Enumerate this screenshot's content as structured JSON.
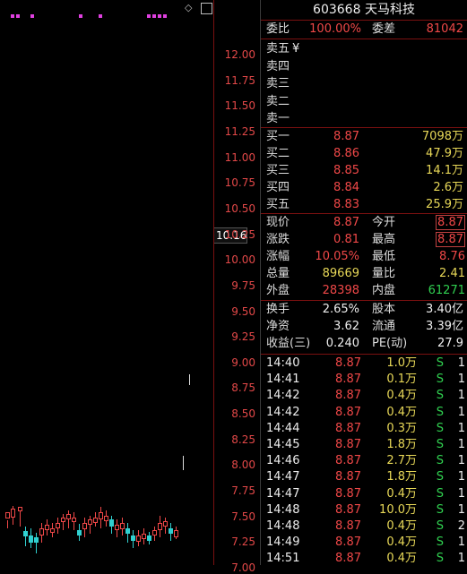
{
  "header": {
    "code": "603668",
    "name": "天马科技"
  },
  "ratio": {
    "label1": "委比",
    "value1": "100.00%",
    "label2": "委差",
    "value2": "81042"
  },
  "sell": [
    {
      "label": "卖五",
      "extra": "¥"
    },
    {
      "label": "卖四"
    },
    {
      "label": "卖三"
    },
    {
      "label": "卖二"
    },
    {
      "label": "卖一"
    }
  ],
  "buy": [
    {
      "label": "买一",
      "price": "8.87",
      "vol": "7098万"
    },
    {
      "label": "买二",
      "price": "8.86",
      "vol": "47.9万"
    },
    {
      "label": "买三",
      "price": "8.85",
      "vol": "14.1万"
    },
    {
      "label": "买四",
      "price": "8.84",
      "vol": "2.6万"
    },
    {
      "label": "买五",
      "price": "8.83",
      "vol": "25.9万"
    }
  ],
  "stats": [
    {
      "l1": "现价",
      "v1": "8.87",
      "l2": "今开",
      "v2": "8.87"
    },
    {
      "l1": "涨跌",
      "v1": "0.81",
      "l2": "最高",
      "v2": "8.87"
    },
    {
      "l1": "涨幅",
      "v1": "10.05%",
      "l2": "最低",
      "v2": "8.76"
    },
    {
      "l1": "总量",
      "v1": "89669",
      "l2": "量比",
      "v2": "2.41"
    },
    {
      "l1": "外盘",
      "v1": "28398",
      "l2": "内盘",
      "v2": "61271"
    }
  ],
  "fund": [
    {
      "l1": "换手",
      "v1": "2.65%",
      "l2": "股本",
      "v2": "3.40亿"
    },
    {
      "l1": "净资",
      "v1": "3.62",
      "l2": "流通",
      "v2": "3.39亿"
    },
    {
      "l1": "收益(三)",
      "v1": "0.240",
      "l2": "PE(动)",
      "v2": "27.9"
    }
  ],
  "ticks": [
    {
      "time": "14:40",
      "price": "8.87",
      "vol": "1.0万",
      "side": "S",
      "n": "1"
    },
    {
      "time": "14:41",
      "price": "8.87",
      "vol": "0.1万",
      "side": "S",
      "n": "1"
    },
    {
      "time": "14:42",
      "price": "8.87",
      "vol": "0.4万",
      "side": "S",
      "n": "1"
    },
    {
      "time": "14:42",
      "price": "8.87",
      "vol": "0.4万",
      "side": "S",
      "n": "1"
    },
    {
      "time": "14:44",
      "price": "8.87",
      "vol": "0.3万",
      "side": "S",
      "n": "1"
    },
    {
      "time": "14:45",
      "price": "8.87",
      "vol": "1.8万",
      "side": "S",
      "n": "1"
    },
    {
      "time": "14:46",
      "price": "8.87",
      "vol": "2.7万",
      "side": "S",
      "n": "1"
    },
    {
      "time": "14:47",
      "price": "8.87",
      "vol": "1.8万",
      "side": "S",
      "n": "1"
    },
    {
      "time": "14:47",
      "price": "8.87",
      "vol": "0.4万",
      "side": "S",
      "n": "1"
    },
    {
      "time": "14:48",
      "price": "8.87",
      "vol": "10.0万",
      "side": "S",
      "n": "1"
    },
    {
      "time": "14:48",
      "price": "8.87",
      "vol": "0.4万",
      "side": "S",
      "n": "2"
    },
    {
      "time": "14:49",
      "price": "8.87",
      "vol": "0.4万",
      "side": "S",
      "n": "1"
    },
    {
      "time": "14:51",
      "price": "8.87",
      "vol": "0.4万",
      "side": "S",
      "n": "1"
    }
  ],
  "yaxis": {
    "ticks": [
      "12.00",
      "11.75",
      "11.50",
      "11.25",
      "11.00",
      "10.75",
      "10.50",
      "10.25",
      "10.00",
      "9.75",
      "9.50",
      "9.25",
      "9.00",
      "8.75",
      "8.50",
      "8.25",
      "8.00",
      "7.75",
      "7.50",
      "7.25",
      "7.00"
    ],
    "current": "10.16"
  },
  "colors": {
    "up": "#f04848",
    "down": "#30d0d0",
    "marker": "#e040e0",
    "border": "#7a1010"
  },
  "icons": {
    "tool1": "diamond-icon",
    "tool2": "panel-toggle-icon"
  }
}
